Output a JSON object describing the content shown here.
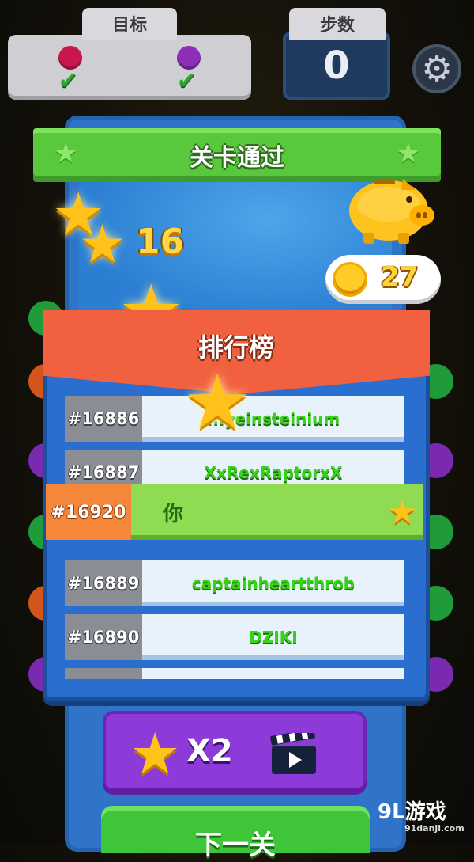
{
  "hud": {
    "goal_label": "目标",
    "goal_items": [
      {
        "color": "#c8174f",
        "done": true
      },
      {
        "color": "#8e2fb8",
        "done": true
      }
    ],
    "moves_label": "步数",
    "moves_value": "0"
  },
  "banner": {
    "title": "关卡通过"
  },
  "stars": {
    "count": "16"
  },
  "coins": {
    "count": "27"
  },
  "leaderboard": {
    "title": "排行榜",
    "rows": [
      {
        "rank": "#16886",
        "name": "...yeinsteinium"
      },
      {
        "rank": "#16887",
        "name": "XxRexRaptorxX"
      },
      {
        "rank": "#16889",
        "name": "captainheartthrob"
      },
      {
        "rank": "#16890",
        "name": "DZIKI"
      }
    ],
    "you": {
      "rank": "#16920",
      "name": "你"
    }
  },
  "buttons": {
    "double_label": "X2",
    "next_label": "下一关"
  },
  "watermark": {
    "brand": "9L游戏",
    "site": "91danji.com"
  },
  "colors": {
    "panel_blue": "#2f74c9",
    "banner_green": "#59c83d",
    "leaderboard_orange": "#f2613f",
    "button_purple": "#8d3bd8",
    "button_green": "#3fc53a"
  }
}
